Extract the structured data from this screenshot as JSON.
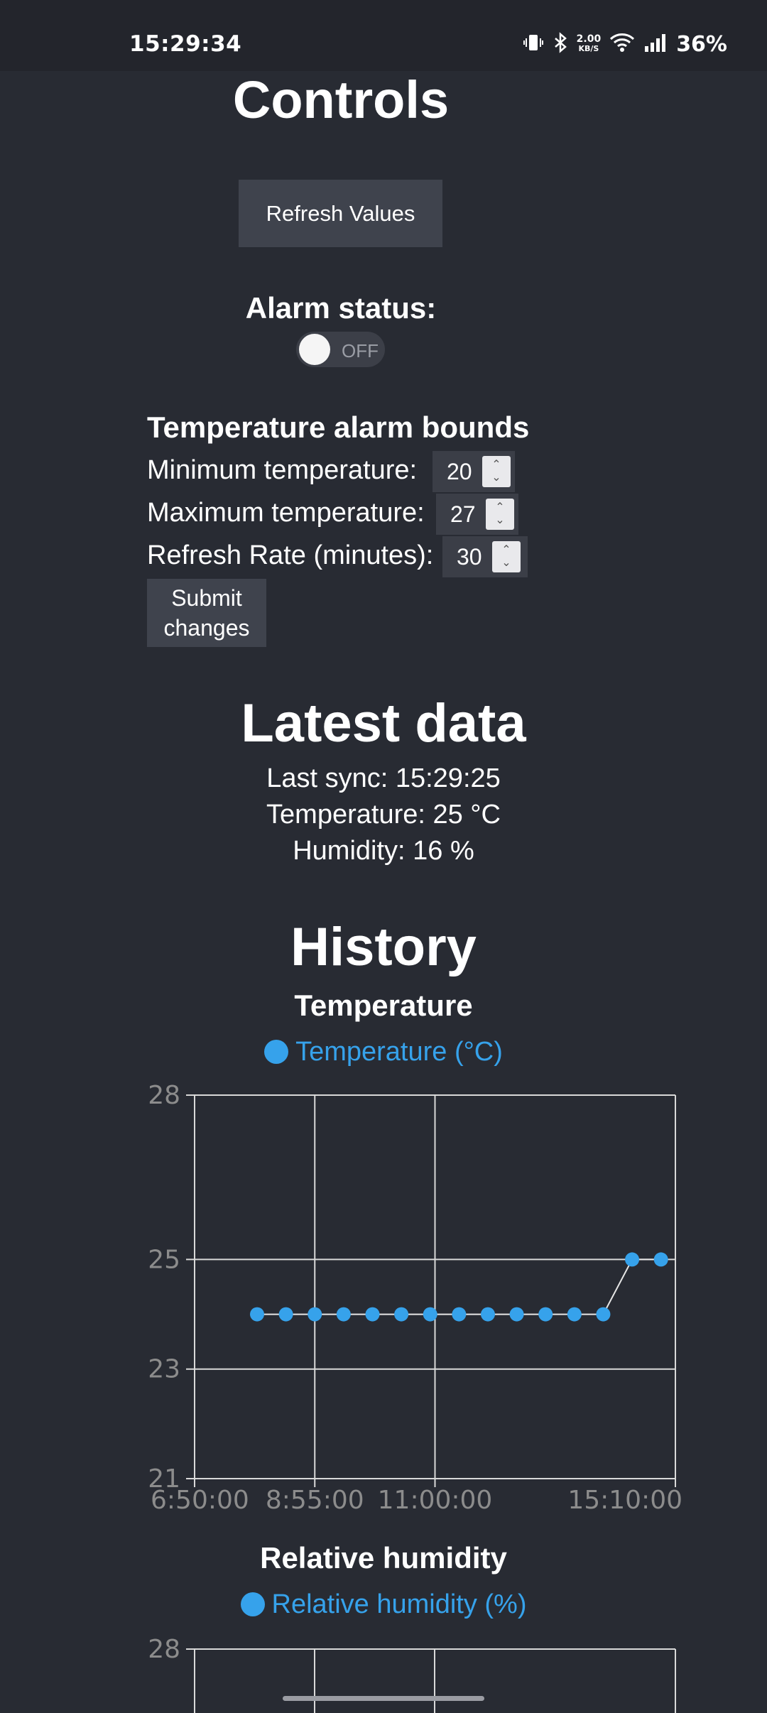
{
  "status_bar": {
    "time": "15:29:34",
    "speed_top": "2.00",
    "speed_bottom": "KB/S",
    "battery": "36%"
  },
  "controls": {
    "title": "Controls",
    "refresh_label": "Refresh Values",
    "alarm_label": "Alarm status:",
    "alarm_toggle_text": "OFF"
  },
  "bounds": {
    "title": "Temperature alarm bounds",
    "min_label": "Minimum temperature:",
    "min_value": "20",
    "max_label": "Maximum temperature:",
    "max_value": "27",
    "rate_label": "Refresh Rate (minutes):",
    "rate_value": "30",
    "submit_line1": "Submit",
    "submit_line2": "changes"
  },
  "latest": {
    "title": "Latest data",
    "last_sync": "Last sync: 15:29:25",
    "temperature": "Temperature: 25 °C",
    "humidity": "Humidity: 16 %"
  },
  "history": {
    "title": "History",
    "temp_chart_title": "Temperature",
    "temp_legend": "Temperature (°C)",
    "hum_chart_title": "Relative humidity",
    "hum_legend": "Relative humidity (%)"
  },
  "colors": {
    "series": "#36a2eb",
    "grid": "#d9d9d9",
    "tick": "#8c8c8c"
  },
  "chart_data": [
    {
      "type": "line",
      "title": "Temperature",
      "series": [
        {
          "name": "Temperature (°C)",
          "x": [
            "7:55:00",
            "8:25:00",
            "8:55:00",
            "9:25:00",
            "9:55:00",
            "10:25:00",
            "10:55:00",
            "11:25:00",
            "11:55:00",
            "12:25:00",
            "12:55:00",
            "13:25:00",
            "13:55:00",
            "14:25:00",
            "14:55:00"
          ],
          "values": [
            24,
            24,
            24,
            24,
            24,
            24,
            24,
            24,
            24,
            24,
            24,
            24,
            24,
            25,
            25
          ]
        }
      ],
      "ylim": [
        21,
        28
      ],
      "yticks": [
        "28",
        "25",
        "23",
        "21"
      ],
      "xticks": [
        "6:50:00",
        "8:55:00",
        "11:00:00",
        "15:10:00"
      ],
      "grid": true,
      "legend": "top"
    },
    {
      "type": "line",
      "title": "Relative humidity",
      "series": [
        {
          "name": "Relative humidity (%)",
          "values": []
        }
      ],
      "yticks": [
        "28"
      ],
      "grid": true,
      "legend": "top"
    }
  ]
}
